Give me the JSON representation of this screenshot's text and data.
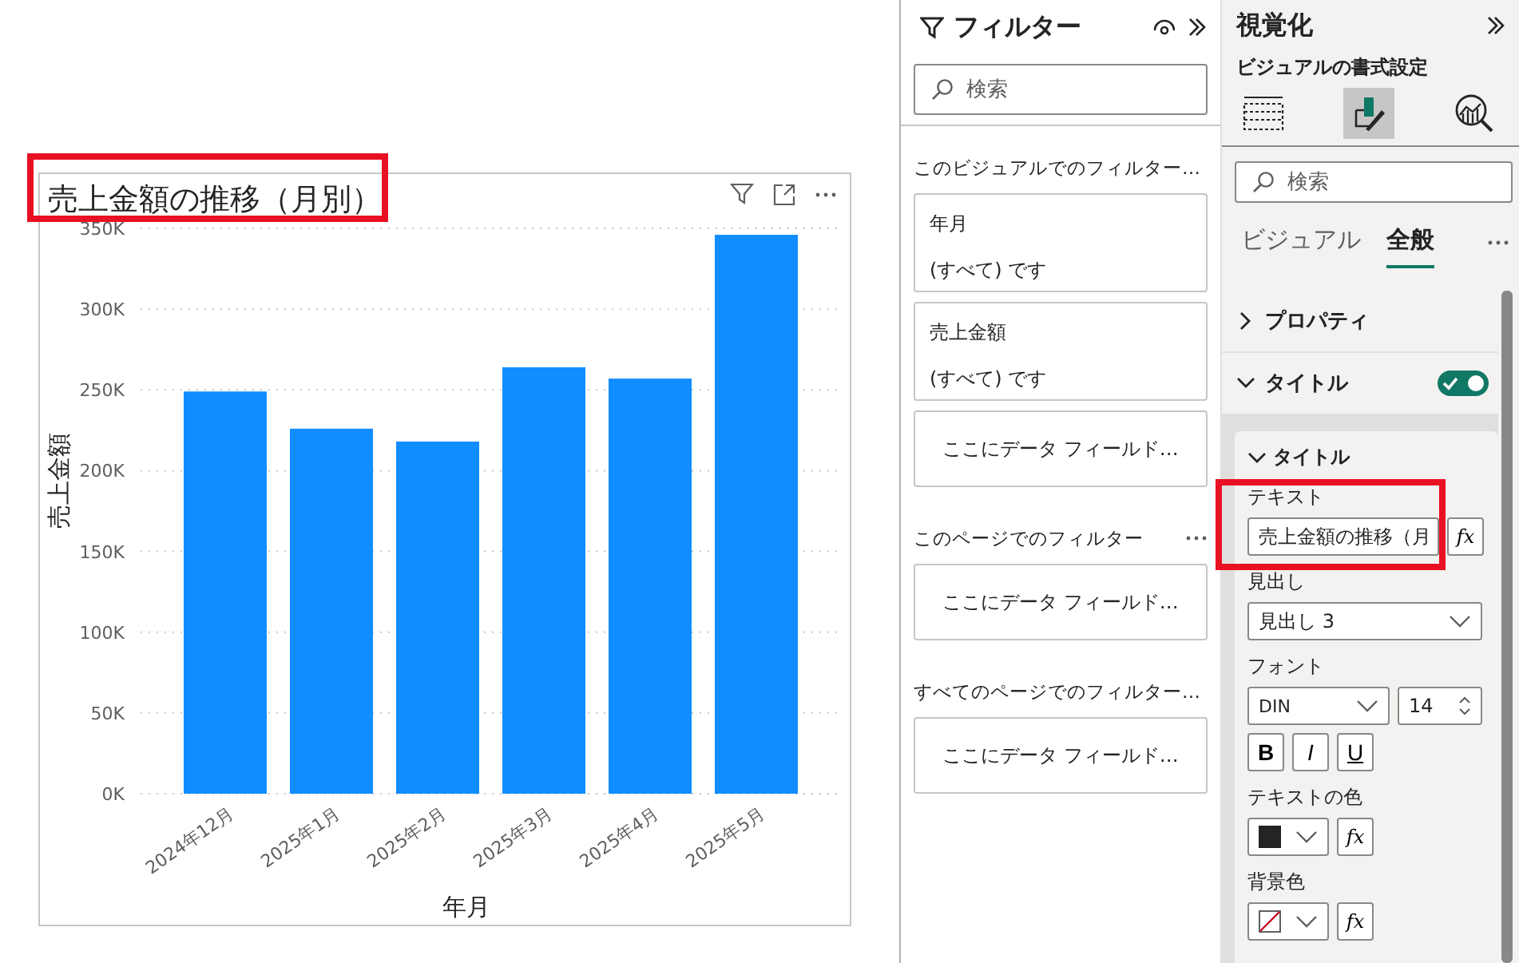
{
  "visual": {
    "title": "売上金額の推移（月別）",
    "title_highlighted": true,
    "chart_data": {
      "type": "bar",
      "grid": true,
      "xlabel": "年月",
      "ylabel": "売上金額",
      "categories": [
        "2024年12月",
        "2025年1月",
        "2025年2月",
        "2025年3月",
        "2025年4月",
        "2025年5月"
      ],
      "values": [
        249000,
        226000,
        218000,
        264000,
        257000,
        346000
      ],
      "ylim": [
        0,
        350000
      ],
      "yticks": [
        {
          "value": 0,
          "label": "0K"
        },
        {
          "value": 50000,
          "label": "50K"
        },
        {
          "value": 100000,
          "label": "100K"
        },
        {
          "value": 150000,
          "label": "150K"
        },
        {
          "value": 200000,
          "label": "200K"
        },
        {
          "value": 250000,
          "label": "250K"
        },
        {
          "value": 300000,
          "label": "300K"
        },
        {
          "value": 350000,
          "label": "350K"
        }
      ]
    }
  },
  "filter_pane": {
    "title": "フィルター",
    "search": {
      "placeholder": "検索"
    },
    "sections": [
      {
        "heading": "このビジュアルでのフィルター…",
        "more_button": false,
        "cards": [
          {
            "kind": "filter",
            "field": "年月",
            "condition": "(すべて) です"
          },
          {
            "kind": "filter",
            "field": "売上金額",
            "condition": "(すべて) です"
          },
          {
            "kind": "drop",
            "text": "ここにデータ フィールド…"
          }
        ]
      },
      {
        "heading": "このページでのフィルター",
        "more_button": true,
        "cards": [
          {
            "kind": "drop",
            "text": "ここにデータ フィールド…"
          }
        ]
      },
      {
        "heading": "すべてのページでのフィルター…",
        "more_button": false,
        "cards": [
          {
            "kind": "drop",
            "text": "ここにデータ フィールド…"
          }
        ]
      }
    ]
  },
  "viz_pane": {
    "title": "視覚化",
    "subtitle": "ビジュアルの書式設定",
    "modes": [
      {
        "kind": "build",
        "selected": false
      },
      {
        "kind": "format",
        "selected": true
      },
      {
        "kind": "analytics",
        "selected": false
      }
    ],
    "search": {
      "placeholder": "検索"
    },
    "tabs": [
      {
        "label": "ビジュアル",
        "selected": false
      },
      {
        "label": "全般",
        "selected": true
      }
    ],
    "sections": [
      {
        "kind": "group",
        "label": "プロパティ",
        "expanded": false
      },
      {
        "kind": "toggle-group",
        "label": "タイトル",
        "expanded": true,
        "on": true
      }
    ],
    "subgroup": {
      "label": "タイトル",
      "expanded": true,
      "fields": [
        {
          "kind": "text",
          "label": "テキスト",
          "value": "売上金額の推移（月",
          "fx": "fx",
          "highlighted": true
        },
        {
          "kind": "dropdown",
          "label": "見出し",
          "value": "見出し 3"
        },
        {
          "kind": "font",
          "label": "フォント",
          "family": "DIN",
          "size": "14",
          "styles": [
            {
              "label": "B",
              "on": false
            },
            {
              "label": "I",
              "on": false
            },
            {
              "label": "U",
              "on": false
            }
          ]
        },
        {
          "kind": "color",
          "label": "テキストの色",
          "color": "#252423",
          "fx": "fx"
        },
        {
          "kind": "no-color",
          "label": "背景色",
          "fx": "fx"
        }
      ]
    }
  }
}
